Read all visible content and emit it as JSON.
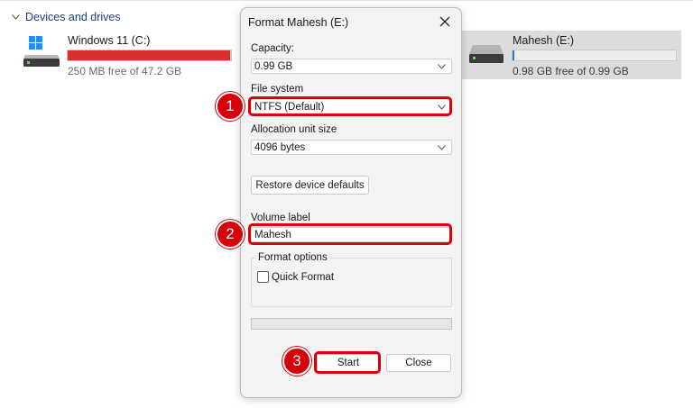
{
  "explorer": {
    "section_title": "Devices and drives",
    "drives": [
      {
        "name": "Windows 11 (C:)",
        "free_text": "250 MB free of 47.2 GB",
        "used_fraction": 0.995,
        "bar_color": "#da2d2d"
      },
      {
        "name": "Mahesh (E:)",
        "free_text": "0.98 GB free of 0.99 GB",
        "used_fraction": 0.01,
        "bar_color": "#2a7bd6"
      }
    ]
  },
  "dialog": {
    "title": "Format Mahesh (E:)",
    "capacity": {
      "label": "Capacity:",
      "value": "0.99 GB"
    },
    "file_system": {
      "label": "File system",
      "value": "NTFS (Default)"
    },
    "allocation": {
      "label": "Allocation unit size",
      "value": "4096 bytes"
    },
    "restore_label": "Restore device defaults",
    "volume": {
      "label": "Volume label",
      "value": "Mahesh"
    },
    "format_options": {
      "title": "Format options",
      "quick_format_label": "Quick Format",
      "quick_format_checked": false
    },
    "progress": 0,
    "start_label": "Start",
    "close_label": "Close"
  },
  "annotations": {
    "badges": [
      "1",
      "2",
      "3"
    ],
    "color": "#d6000b"
  }
}
